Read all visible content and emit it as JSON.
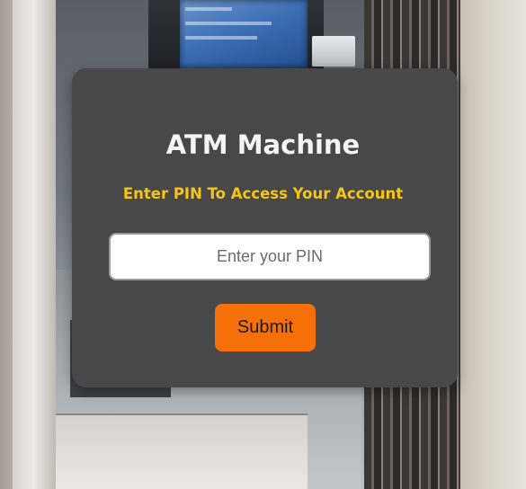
{
  "card": {
    "title": "ATM Machine",
    "subtitle": "Enter PIN To Access Your Account"
  },
  "pin": {
    "value": "",
    "placeholder": "Enter your PIN"
  },
  "actions": {
    "submit_label": "Submit"
  },
  "colors": {
    "card_background": "#484848",
    "title_text": "#f4f4f4",
    "subtitle_accent": "#f5c518",
    "submit_button": "#f57009"
  }
}
